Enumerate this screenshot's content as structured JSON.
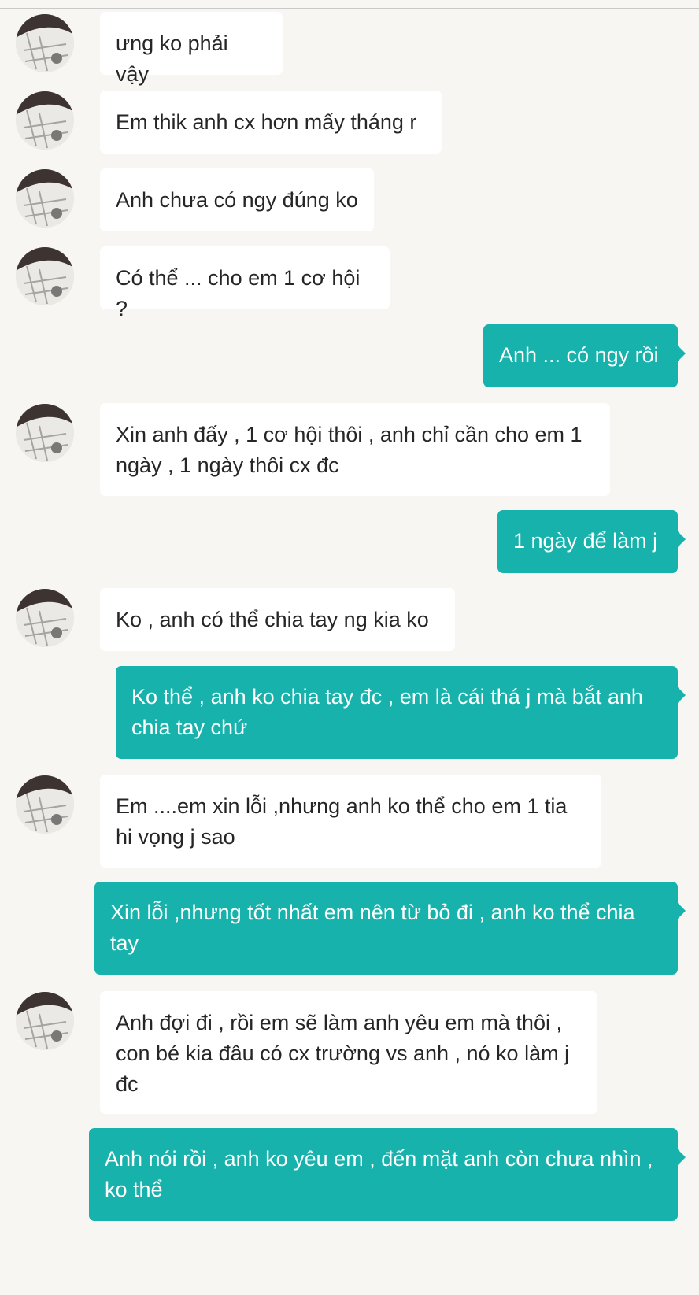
{
  "conversation": {
    "colors": {
      "background": "#f7f6f2",
      "incoming_bubble": "#ffffff",
      "outgoing_bubble": "#16b2ab",
      "incoming_text": "#262626",
      "outgoing_text": "#ffffff"
    },
    "messages": [
      {
        "side": "incoming",
        "text": "ưng ko phải vậy"
      },
      {
        "side": "incoming",
        "text": "Em thik anh cx hơn mấy tháng r"
      },
      {
        "side": "incoming",
        "text": "Anh chưa có ngy đúng ko"
      },
      {
        "side": "incoming",
        "text": "Có thể ... cho em 1 cơ hội ?"
      },
      {
        "side": "outgoing",
        "text": "Anh ... có ngy rồi"
      },
      {
        "side": "incoming",
        "text": "Xin anh đấy , 1 cơ hội thôi , anh chỉ cần cho em 1 ngày , 1 ngày thôi cx đc"
      },
      {
        "side": "outgoing",
        "text": "1 ngày để làm j"
      },
      {
        "side": "incoming",
        "text": "Ko , anh có thể chia tay ng kia ko"
      },
      {
        "side": "outgoing",
        "text": "Ko thể , anh ko chia tay đc , em là cái thá j mà bắt anh chia tay chứ"
      },
      {
        "side": "incoming",
        "text": "Em ....em xin lỗi ,nhưng anh ko thể cho em 1 tia hi vọng j sao"
      },
      {
        "side": "outgoing",
        "text": "Xin lỗi ,nhưng tốt nhất em nên từ bỏ đi , anh ko thể chia tay"
      },
      {
        "side": "incoming",
        "text": "Anh đợi đi , rồi em sẽ làm anh yêu em mà thôi , con bé kia đâu có cx trường vs anh , nó ko làm j đc"
      },
      {
        "side": "outgoing",
        "text": "Anh nói rồi , anh ko yêu em , đến mặt anh còn chưa nhìn , ko thể"
      }
    ]
  }
}
